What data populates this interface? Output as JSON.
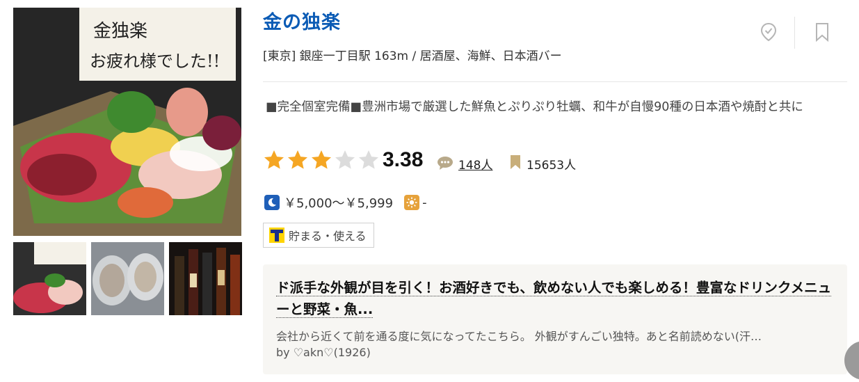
{
  "restaurant": {
    "name": "金の独楽",
    "area": "[東京] 銀座一丁目駅 163m / 居酒屋、海鮮、日本酒バー",
    "pr": "■完全個室完備■豊洲市場で厳選した鮮魚とぷりぷり牡蠣、和牛が自慢90種の日本酒や焼酎と共に",
    "rating": {
      "score": "3.38",
      "stars": 3,
      "max_stars": 5,
      "review_count": "148人",
      "save_count": "15653人"
    },
    "price": {
      "dinner": "￥5,000～￥5,999",
      "lunch": "-"
    },
    "tpoint_label": "貯まる・使える",
    "photo_sign_text": "金独楽 お疲れ様でした!!"
  },
  "review": {
    "title": "ド派手な外観が目を引く！お酒好きでも、飲めない人でも楽しめる！豊富なドリンクメニューと野菜・魚...",
    "body": "会社から近くて前を通る度に気になってたこちら。 外観がすんごい独特。あと名前読めない(汗…",
    "author": "by ♡akn♡(1926)"
  },
  "colors": {
    "title": "#0b5bb5",
    "star_on": "#f5a623",
    "star_off": "#dcdcdc",
    "bookmark": "#c8ae7a",
    "night_badge": "#1f5fb8",
    "day_badge": "#e6a23b"
  },
  "icons": [
    "pin-check-icon",
    "bookmark-icon",
    "speech-bubble-icon",
    "bookmark-small-icon",
    "moon-icon",
    "sun-icon",
    "t-point-icon"
  ]
}
